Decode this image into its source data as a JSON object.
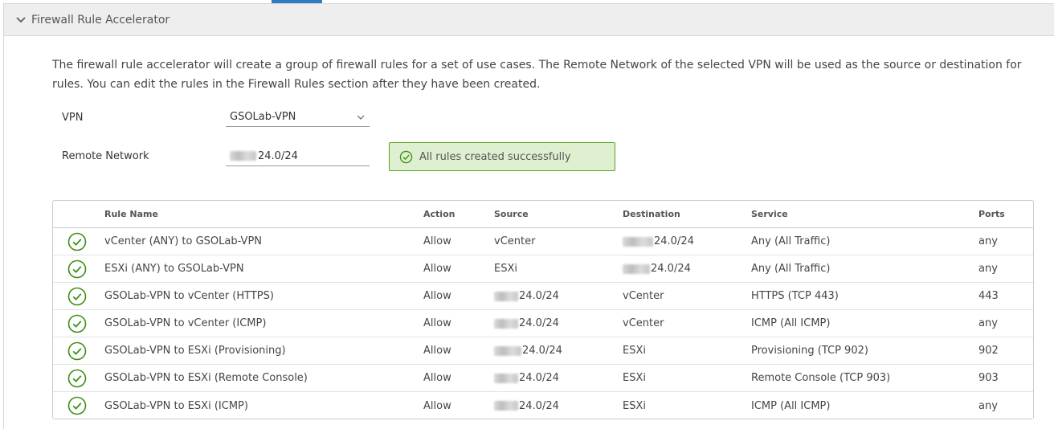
{
  "panel": {
    "title": "Firewall Rule Accelerator"
  },
  "description": "The firewall rule accelerator will create a group of firewall rules for a set of use cases. The Remote Network of the selected VPN will be used as the source or destination for rules. You can edit the rules in the Firewall Rules section after they have been created.",
  "form": {
    "vpn_label": "VPN",
    "vpn_value": "GSOLab-VPN",
    "remote_label": "Remote Network",
    "remote_value_suffix": "24.0/24"
  },
  "alert": {
    "text": "All rules created successfully",
    "color": "#5aa220"
  },
  "table": {
    "columns": {
      "rule_name": "Rule Name",
      "action": "Action",
      "source": "Source",
      "destination": "Destination",
      "service": "Service",
      "ports": "Ports"
    },
    "rows": [
      {
        "status": "success-icon",
        "rule_name": "vCenter (ANY) to GSOLab-VPN",
        "action": "Allow",
        "source": "vCenter",
        "destination": "24.0/24",
        "dest_redacted": true,
        "service": "Any (All Traffic)",
        "ports": "any"
      },
      {
        "status": "success-icon",
        "rule_name": "ESXi (ANY) to GSOLab-VPN",
        "action": "Allow",
        "source": "ESXi",
        "destination": "24.0/24",
        "dest_redacted": true,
        "service": "Any (All Traffic)",
        "ports": "any"
      },
      {
        "status": "success-icon",
        "rule_name": "GSOLab-VPN to vCenter (HTTPS)",
        "action": "Allow",
        "source": "24.0/24",
        "source_redacted": true,
        "destination": "vCenter",
        "service": "HTTPS (TCP 443)",
        "ports": "443"
      },
      {
        "status": "success-icon",
        "rule_name": "GSOLab-VPN to vCenter (ICMP)",
        "action": "Allow",
        "source": "24.0/24",
        "source_redacted": true,
        "destination": "vCenter",
        "service": "ICMP (All ICMP)",
        "ports": "any"
      },
      {
        "status": "success-icon",
        "rule_name": "GSOLab-VPN to ESXi (Provisioning)",
        "action": "Allow",
        "source": "24.0/24",
        "source_redacted": true,
        "destination": "ESXi",
        "service": "Provisioning (TCP 902)",
        "ports": "902"
      },
      {
        "status": "success-icon",
        "rule_name": "GSOLab-VPN to ESXi (Remote Console)",
        "action": "Allow",
        "source": "24.0/24",
        "source_redacted": true,
        "destination": "ESXi",
        "service": "Remote Console (TCP 903)",
        "ports": "903"
      },
      {
        "status": "success-icon",
        "rule_name": "GSOLab-VPN to ESXi (ICMP)",
        "action": "Allow",
        "source": "24.0/24",
        "source_redacted": true,
        "destination": "ESXi",
        "service": "ICMP (All ICMP)",
        "ports": "any"
      }
    ]
  },
  "colors": {
    "accent": "#2f7dc0",
    "success": "#5aa220"
  }
}
